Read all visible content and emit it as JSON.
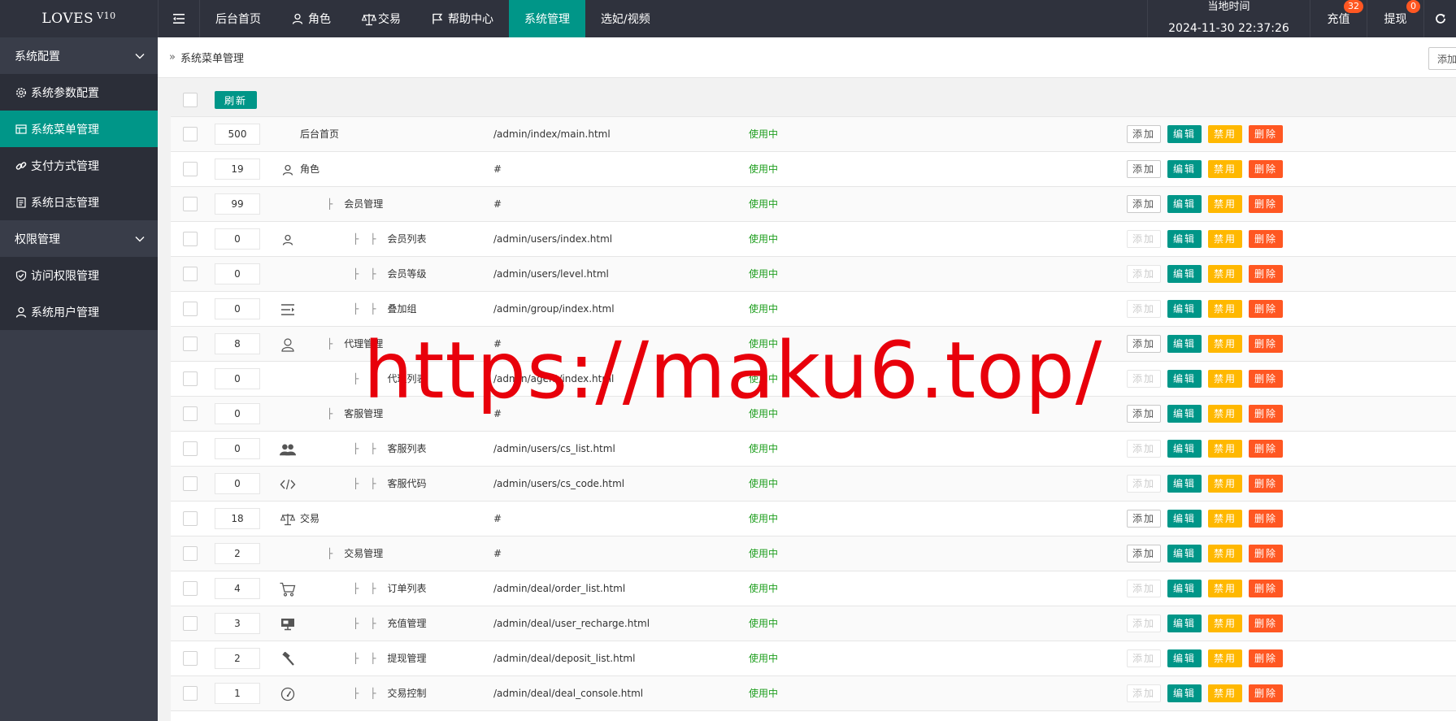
{
  "logo": {
    "name": "LOVES",
    "version": "V10"
  },
  "topnav": [
    {
      "label": "后台首页",
      "icon": ""
    },
    {
      "label": "角色",
      "icon": "user-icon"
    },
    {
      "label": "交易",
      "icon": "scale-icon"
    },
    {
      "label": "帮助中心",
      "icon": "flag-icon"
    },
    {
      "label": "系统管理",
      "icon": "",
      "active": true
    },
    {
      "label": "选妃/视频",
      "icon": ""
    }
  ],
  "header_right": {
    "clock_label": "当地时间",
    "clock_value": "2024-11-30 22:37:26",
    "recharge_label": "充值",
    "recharge_badge": "32",
    "withdraw_label": "提现",
    "withdraw_badge": "0"
  },
  "sidebar": [
    {
      "type": "group",
      "label": "系统配置"
    },
    {
      "type": "item",
      "label": "系统参数配置",
      "icon": "gear-icon"
    },
    {
      "type": "item",
      "label": "系统菜单管理",
      "icon": "menu-table-icon",
      "active": true
    },
    {
      "type": "item",
      "label": "支付方式管理",
      "icon": "link-icon"
    },
    {
      "type": "item",
      "label": "系统日志管理",
      "icon": "log-icon"
    },
    {
      "type": "group",
      "label": "权限管理"
    },
    {
      "type": "item",
      "label": "访问权限管理",
      "icon": "shield-check-icon"
    },
    {
      "type": "item",
      "label": "系统用户管理",
      "icon": "user-icon"
    }
  ],
  "breadcrumb": {
    "text": "系统菜单管理",
    "add_menu_label": "添加菜"
  },
  "toolbar": {
    "refresh_label": "刷新"
  },
  "ops": {
    "add": "添加",
    "edit": "编辑",
    "ban": "禁用",
    "del": "删除"
  },
  "rows": [
    {
      "sort": "500",
      "icon": "",
      "level": 0,
      "title": "后台首页",
      "url": "/admin/index/main.html",
      "status": "使用中",
      "add_enabled": true
    },
    {
      "sort": "19",
      "icon": "user-icon",
      "level": 0,
      "title": "角色",
      "url": "#",
      "status": "使用中",
      "add_enabled": true
    },
    {
      "sort": "99",
      "icon": "",
      "level": 1,
      "title": "会员管理",
      "url": "#",
      "status": "使用中",
      "add_enabled": true
    },
    {
      "sort": "0",
      "icon": "user-icon",
      "level": 2,
      "title": "会员列表",
      "url": "/admin/users/index.html",
      "status": "使用中",
      "add_enabled": false
    },
    {
      "sort": "0",
      "icon": "",
      "level": 2,
      "title": "会员等级",
      "url": "/admin/users/level.html",
      "status": "使用中",
      "add_enabled": false
    },
    {
      "sort": "0",
      "icon": "indent-icon",
      "level": 2,
      "title": "叠加组",
      "url": "/admin/group/index.html",
      "status": "使用中",
      "add_enabled": false
    },
    {
      "sort": "8",
      "icon": "user-outline-icon",
      "level": 1,
      "title": "代理管理",
      "url": "#",
      "status": "使用中",
      "add_enabled": true
    },
    {
      "sort": "0",
      "icon": "",
      "level": 2,
      "title": "代理列表",
      "url": "/admin/agent/index.html",
      "status": "使用中",
      "add_enabled": false
    },
    {
      "sort": "0",
      "icon": "",
      "level": 1,
      "title": "客服管理",
      "url": "#",
      "status": "使用中",
      "add_enabled": true
    },
    {
      "sort": "0",
      "icon": "users-icon",
      "level": 2,
      "title": "客服列表",
      "url": "/admin/users/cs_list.html",
      "status": "使用中",
      "add_enabled": false
    },
    {
      "sort": "0",
      "icon": "code-icon",
      "level": 2,
      "title": "客服代码",
      "url": "/admin/users/cs_code.html",
      "status": "使用中",
      "add_enabled": false
    },
    {
      "sort": "18",
      "icon": "scale-icon",
      "level": 0,
      "title": "交易",
      "url": "#",
      "status": "使用中",
      "add_enabled": true
    },
    {
      "sort": "2",
      "icon": "",
      "level": 1,
      "title": "交易管理",
      "url": "#",
      "status": "使用中",
      "add_enabled": true
    },
    {
      "sort": "4",
      "icon": "cart-icon",
      "level": 2,
      "title": "订单列表",
      "url": "/admin/deal/order_list.html",
      "status": "使用中",
      "add_enabled": false
    },
    {
      "sort": "3",
      "icon": "monitor-icon",
      "level": 2,
      "title": "充值管理",
      "url": "/admin/deal/user_recharge.html",
      "status": "使用中",
      "add_enabled": false
    },
    {
      "sort": "2",
      "icon": "gavel-icon",
      "level": 2,
      "title": "提现管理",
      "url": "/admin/deal/deposit_list.html",
      "status": "使用中",
      "add_enabled": false
    },
    {
      "sort": "1",
      "icon": "gauge-icon",
      "level": 2,
      "title": "交易控制",
      "url": "/admin/deal/deal_console.html",
      "status": "使用中",
      "add_enabled": false
    }
  ],
  "watermark": "https://maku6.top/"
}
